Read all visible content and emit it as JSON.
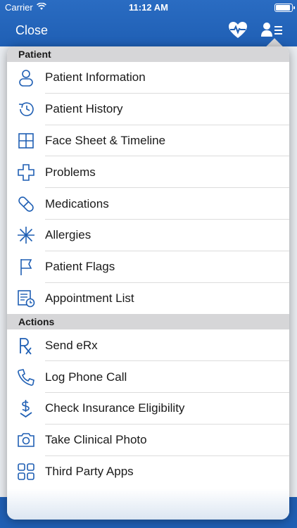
{
  "status": {
    "carrier": "Carrier",
    "time": "11:12 AM"
  },
  "nav": {
    "close_label": "Close"
  },
  "popover": {
    "sections": [
      {
        "header": "Patient",
        "items": [
          {
            "label": "Patient Information",
            "icon": "person-icon"
          },
          {
            "label": "Patient History",
            "icon": "history-icon"
          },
          {
            "label": "Face Sheet & Timeline",
            "icon": "grid-icon"
          },
          {
            "label": "Problems",
            "icon": "medical-cross-icon"
          },
          {
            "label": "Medications",
            "icon": "pill-icon"
          },
          {
            "label": "Allergies",
            "icon": "asterisk-icon"
          },
          {
            "label": "Patient Flags",
            "icon": "flag-icon"
          },
          {
            "label": "Appointment List",
            "icon": "appointment-list-icon"
          }
        ]
      },
      {
        "header": "Actions",
        "items": [
          {
            "label": "Send eRx",
            "icon": "rx-icon"
          },
          {
            "label": "Log Phone Call",
            "icon": "phone-icon"
          },
          {
            "label": "Check Insurance Eligibility",
            "icon": "dollar-check-icon"
          },
          {
            "label": "Take Clinical Photo",
            "icon": "camera-icon"
          },
          {
            "label": "Third Party Apps",
            "icon": "apps-grid-icon"
          }
        ]
      }
    ]
  },
  "colors": {
    "nav_bar": "#1f5fb4",
    "icon_blue": "#1f5fb4",
    "section_header": "#d6d6d8"
  }
}
